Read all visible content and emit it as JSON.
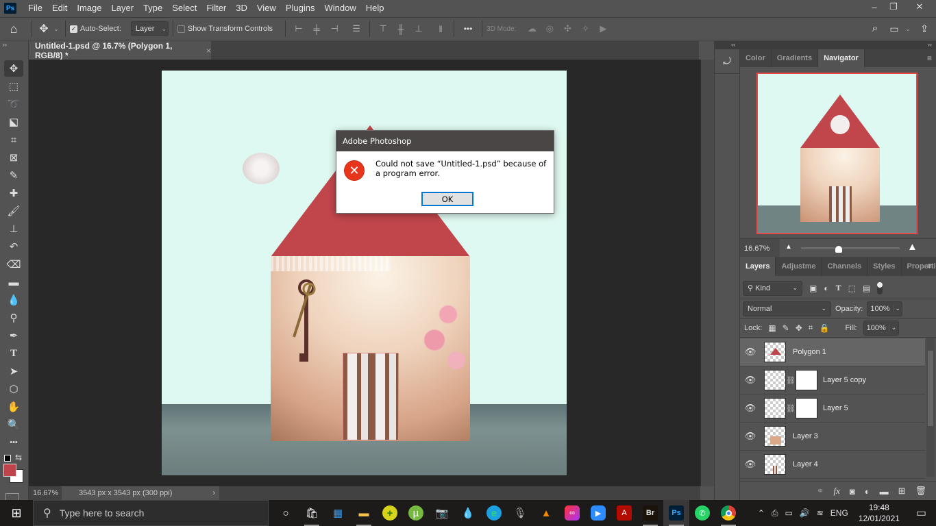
{
  "app": {
    "logo": "Ps",
    "name": "Adobe Photoshop"
  },
  "menu": [
    "File",
    "Edit",
    "Image",
    "Layer",
    "Type",
    "Select",
    "Filter",
    "3D",
    "View",
    "Plugins",
    "Window",
    "Help"
  ],
  "window_controls": {
    "minimize": "–",
    "restore": "❐",
    "close": "✕"
  },
  "options_bar": {
    "home_icon": "home-icon",
    "auto_select_label": "Auto-Select:",
    "auto_select_checked": true,
    "auto_select_target": "Layer",
    "show_transform_label": "Show Transform Controls",
    "show_transform_checked": false,
    "more": "•••",
    "mode_3d_label": "3D Mode:"
  },
  "document_tab": {
    "title": "Untitled-1.psd @ 16.7% (Polygon 1, RGB/8) *",
    "close": "×"
  },
  "tools": [
    {
      "name": "move-tool",
      "glyph": "✥"
    },
    {
      "name": "marquee-tool",
      "glyph": "⬚"
    },
    {
      "name": "lasso-tool",
      "glyph": "➰"
    },
    {
      "name": "object-select-tool",
      "glyph": "⬕"
    },
    {
      "name": "crop-tool",
      "glyph": "⌗"
    },
    {
      "name": "frame-tool",
      "glyph": "⊠"
    },
    {
      "name": "eyedropper-tool",
      "glyph": "✎"
    },
    {
      "name": "healing-tool",
      "glyph": "✚"
    },
    {
      "name": "brush-tool",
      "glyph": "🖌"
    },
    {
      "name": "stamp-tool",
      "glyph": "⊥"
    },
    {
      "name": "history-brush-tool",
      "glyph": "↶"
    },
    {
      "name": "eraser-tool",
      "glyph": "⌫"
    },
    {
      "name": "gradient-tool",
      "glyph": "▬"
    },
    {
      "name": "blur-tool",
      "glyph": "💧"
    },
    {
      "name": "dodge-tool",
      "glyph": "⚲"
    },
    {
      "name": "pen-tool",
      "glyph": "✒"
    },
    {
      "name": "type-tool",
      "glyph": "T"
    },
    {
      "name": "path-select-tool",
      "glyph": "➤"
    },
    {
      "name": "shape-tool",
      "glyph": "⬡"
    },
    {
      "name": "hand-tool",
      "glyph": "✋"
    },
    {
      "name": "zoom-tool",
      "glyph": "🔍"
    },
    {
      "name": "more-tools",
      "glyph": "•••"
    }
  ],
  "colors": {
    "foreground": "#c0444b",
    "background": "#ffffff",
    "roof": "#c0464c",
    "sky": "#def9f1",
    "accent_nav": "#e84a4a",
    "dialog_ok_border": "#0078d7",
    "error_icon": "#e8361c"
  },
  "status_bar": {
    "zoom": "16.67%",
    "info": "3543 px x 3543 px (300 ppi)",
    "arrow": "›"
  },
  "dialog": {
    "title": "Adobe Photoshop",
    "message": "Could not save “Untitled-1.psd” because of a program error.",
    "ok_label": "OK",
    "icon": "error-icon"
  },
  "right_panel": {
    "top_tabs": [
      {
        "label": "Color"
      },
      {
        "label": "Gradients"
      },
      {
        "label": "Navigator",
        "active": true
      }
    ],
    "navigator": {
      "zoom": "16.67%",
      "zoom_slider_fraction": 0.38
    },
    "layer_tabs": [
      {
        "label": "Layers",
        "active": true
      },
      {
        "label": "Adjustme"
      },
      {
        "label": "Channels"
      },
      {
        "label": "Styles"
      },
      {
        "label": "Propertie"
      }
    ],
    "filter": {
      "kind_label": "Kind"
    },
    "blend_mode": "Normal",
    "opacity_label": "Opacity:",
    "opacity": "100%",
    "lock_label": "Lock:",
    "fill_label": "Fill:",
    "fill": "100%",
    "layers": [
      {
        "name": "Polygon 1",
        "selected": true,
        "has_mask": false,
        "visible": true
      },
      {
        "name": "Layer 5 copy",
        "selected": false,
        "has_mask": true,
        "visible": true
      },
      {
        "name": "Layer 5",
        "selected": false,
        "has_mask": true,
        "visible": true
      },
      {
        "name": "Layer 3",
        "selected": false,
        "has_mask": false,
        "visible": true
      },
      {
        "name": "Layer 4",
        "selected": false,
        "has_mask": false,
        "visible": true
      }
    ],
    "footer_icons": [
      "link-icon",
      "fx-icon",
      "mask-icon",
      "adjustment-icon",
      "group-icon",
      "new-layer-icon",
      "trash-icon"
    ]
  },
  "taskbar": {
    "search_placeholder": "Type here to search",
    "apps": [
      "cortana",
      "microsoft-store",
      "control-panel",
      "file-explorer",
      "app-plus",
      "utorrent",
      "photo-viewer",
      "paint-3d",
      "edge",
      "voice-recorder",
      "vlc",
      "creative-cloud",
      "zoom",
      "acrobat",
      "bridge",
      "photoshop",
      "whatsapp",
      "chrome"
    ],
    "tray": {
      "language": "ENG",
      "time": "19:48",
      "date": "12/01/2021"
    }
  }
}
